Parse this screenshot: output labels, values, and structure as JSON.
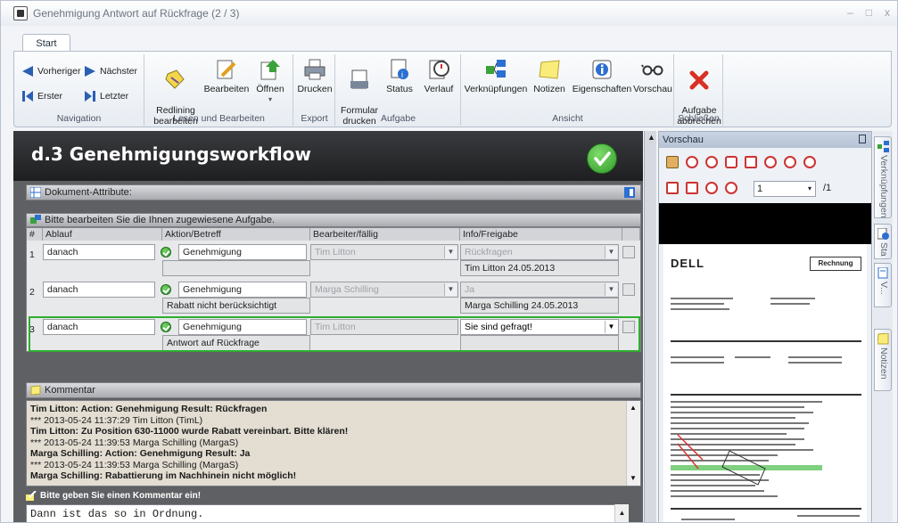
{
  "window": {
    "title": "Genehmigung Antwort auf Rückfrage (2 / 3)",
    "controls": [
      "–",
      "□",
      "x"
    ]
  },
  "tabs": {
    "start": "Start"
  },
  "ribbon": {
    "navigation": {
      "label": "Navigation",
      "prev": "Vorheriger",
      "next": "Nächster",
      "first": "Erster",
      "last": "Letzter"
    },
    "lesen": {
      "label": "Lesen und Bearbeiten",
      "redlining": "Redlining\nbearbeiten",
      "bearbeiten": "Bearbeiten",
      "oeffnen": "Öffnen"
    },
    "export": {
      "label": "Export",
      "drucken": "Drucken"
    },
    "aufgabe": {
      "label": "Aufgabe",
      "formular": "Formular\ndrucken",
      "status": "Status",
      "verlauf": "Verlauf"
    },
    "ansicht": {
      "label": "Ansicht",
      "verknuepfungen": "Verknüpfungen",
      "notizen": "Notizen",
      "eigenschaften": "Eigenschaften",
      "vorschau": "Vorschau"
    },
    "schliessen": {
      "label": "Schließen",
      "abbrechen": "Aufgabe\nabbrechen"
    }
  },
  "document": {
    "title": "d.3 Genehmigungsworkflow",
    "attributes_header": "Dokument-Attribute:",
    "tasks_header": "Bitte bearbeiten Sie die Ihnen zugewiesene Aufgabe.",
    "columns": [
      "#",
      "Ablauf",
      "Aktion/Betreff",
      "Bearbeiter/fällig",
      "Info/Freigabe"
    ],
    "rows": [
      {
        "num": "1",
        "ablauf": "danach",
        "aktion": "Genehmigung",
        "bearbeiter": "Tim Litton",
        "info": "Rückfragen",
        "betreff": "",
        "freigabe": "Tim Litton 24.05.2013"
      },
      {
        "num": "2",
        "ablauf": "danach",
        "aktion": "Genehmigung",
        "bearbeiter": "Marga Schilling",
        "info": "Ja",
        "betreff": "Rabatt nicht berücksichtigt",
        "freigabe": "Marga Schilling 24.05.2013"
      },
      {
        "num": "3",
        "ablauf": "danach",
        "aktion": "Genehmigung",
        "bearbeiter": "Tim Litton",
        "info": "Sie sind gefragt!",
        "betreff": "Antwort auf Rückfrage",
        "freigabe": ""
      }
    ],
    "comment_header": "Kommentar",
    "comments": [
      {
        "text": "Tim Litton: Action: Genehmigung Result: Rückfragen",
        "bold": true
      },
      {
        "text": "*** 2013-05-24 11:37:29 Tim Litton (TimL)",
        "bold": false
      },
      {
        "text": "Tim Litton: Zu Position 630-11000 wurde Rabatt vereinbart. Bitte klären!",
        "bold": true
      },
      {
        "text": "*** 2013-05-24 11:39:53 Marga Schilling (MargaS)",
        "bold": false
      },
      {
        "text": "Marga Schilling: Action: Genehmigung Result: Ja",
        "bold": true
      },
      {
        "text": "*** 2013-05-24 11:39:53 Marga Schilling (MargaS)",
        "bold": false
      },
      {
        "text": "Marga Schilling: Rabattierung im Nachhinein nicht möglich!",
        "bold": true
      }
    ],
    "prompt": "Bitte geben Sie einen Kommentar ein!",
    "input_value": "Dann ist das so in Ordnung."
  },
  "preview": {
    "title": "Vorschau",
    "page": "1",
    "total": "/1",
    "doc_brand": "DELL",
    "doc_heading": "Rechnung"
  },
  "sidetabs": {
    "verknuepfungen": "Verknüpfungen",
    "status": "Sta",
    "v": "V...",
    "notizen": "Notizen"
  },
  "colors": {
    "accent_green": "#2eae2e",
    "doc_header": "#1e1f21",
    "ribbon_bg": "#e7ecf2"
  }
}
